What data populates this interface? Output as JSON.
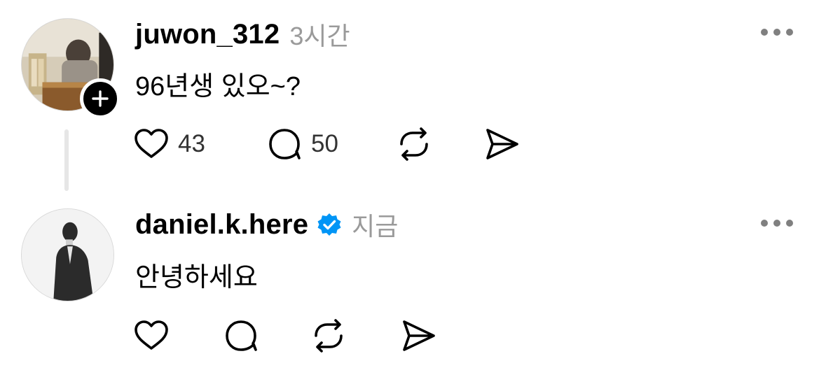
{
  "posts": [
    {
      "username": "juwon_312",
      "timestamp": "3시간",
      "text": "96년생 있오~?",
      "likes": "43",
      "replies": "50",
      "verified": false,
      "has_follow_badge": true,
      "avatar": "photo-of-person-at-table"
    },
    {
      "username": "daniel.k.here",
      "timestamp": "지금",
      "text": "안녕하세요",
      "likes": "",
      "replies": "",
      "verified": true,
      "has_follow_badge": false,
      "avatar": "grayscale-photo-of-person-in-suit"
    }
  ],
  "icons": {
    "like": "heart-icon",
    "reply": "speech-bubble-icon",
    "repost": "repost-icon",
    "share": "send-icon",
    "more": "more-icon",
    "follow": "plus-icon",
    "verified": "verified-badge-icon"
  },
  "colors": {
    "text": "#000000",
    "muted": "#9a9a9a",
    "verified": "#0095f6",
    "thread_line": "#e6e6e6"
  }
}
